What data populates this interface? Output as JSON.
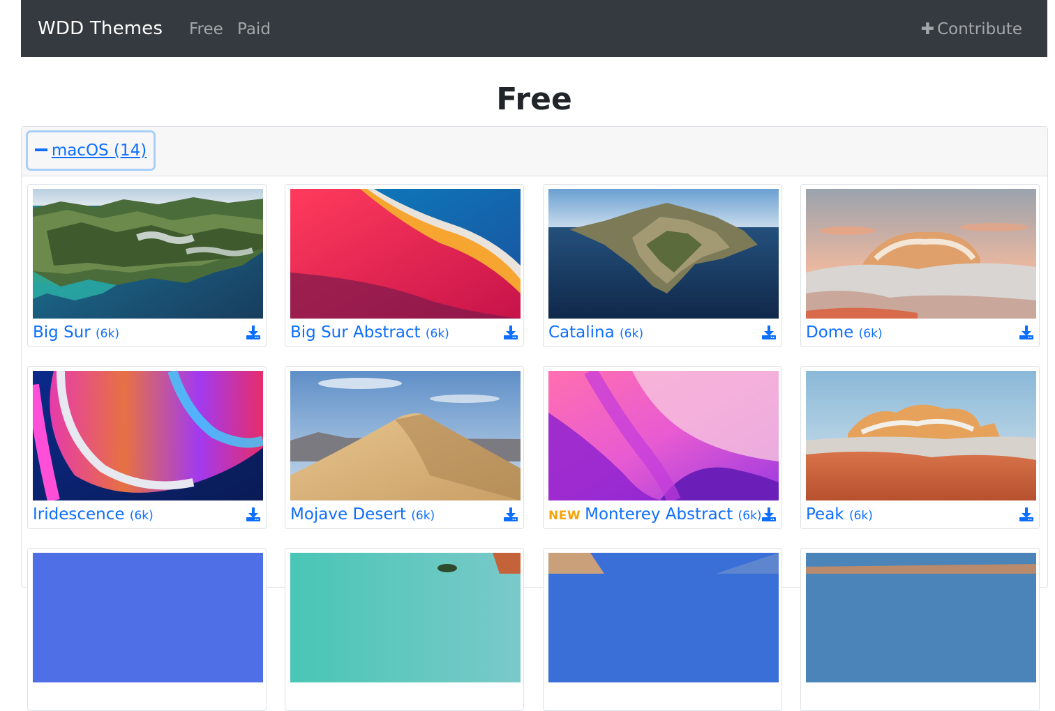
{
  "navbar": {
    "brand": "WDD Themes",
    "links": [
      {
        "label": "Free"
      },
      {
        "label": "Paid"
      }
    ],
    "contribute": {
      "icon": "plus-icon",
      "label": "Contribute"
    }
  },
  "page": {
    "title": "Free"
  },
  "accordion": {
    "toggle_label": "macOS (14)",
    "toggle_icon": "minus-icon"
  },
  "theme": {
    "accent": "#0d6efd",
    "navbar_bg": "#343a40",
    "new_badge_color": "#f5a30a"
  },
  "themes": [
    {
      "name": "Big Sur",
      "size": "(6k)",
      "badge": ""
    },
    {
      "name": "Big Sur Abstract",
      "size": "(6k)",
      "badge": ""
    },
    {
      "name": "Catalina",
      "size": "(6k)",
      "badge": ""
    },
    {
      "name": "Dome",
      "size": "(6k)",
      "badge": ""
    },
    {
      "name": "Iridescence",
      "size": "(6k)",
      "badge": ""
    },
    {
      "name": "Mojave Desert",
      "size": "(6k)",
      "badge": ""
    },
    {
      "name": "Monterey Abstract",
      "size": "(6k)",
      "badge": "NEW"
    },
    {
      "name": "Peak",
      "size": "(6k)",
      "badge": ""
    }
  ]
}
